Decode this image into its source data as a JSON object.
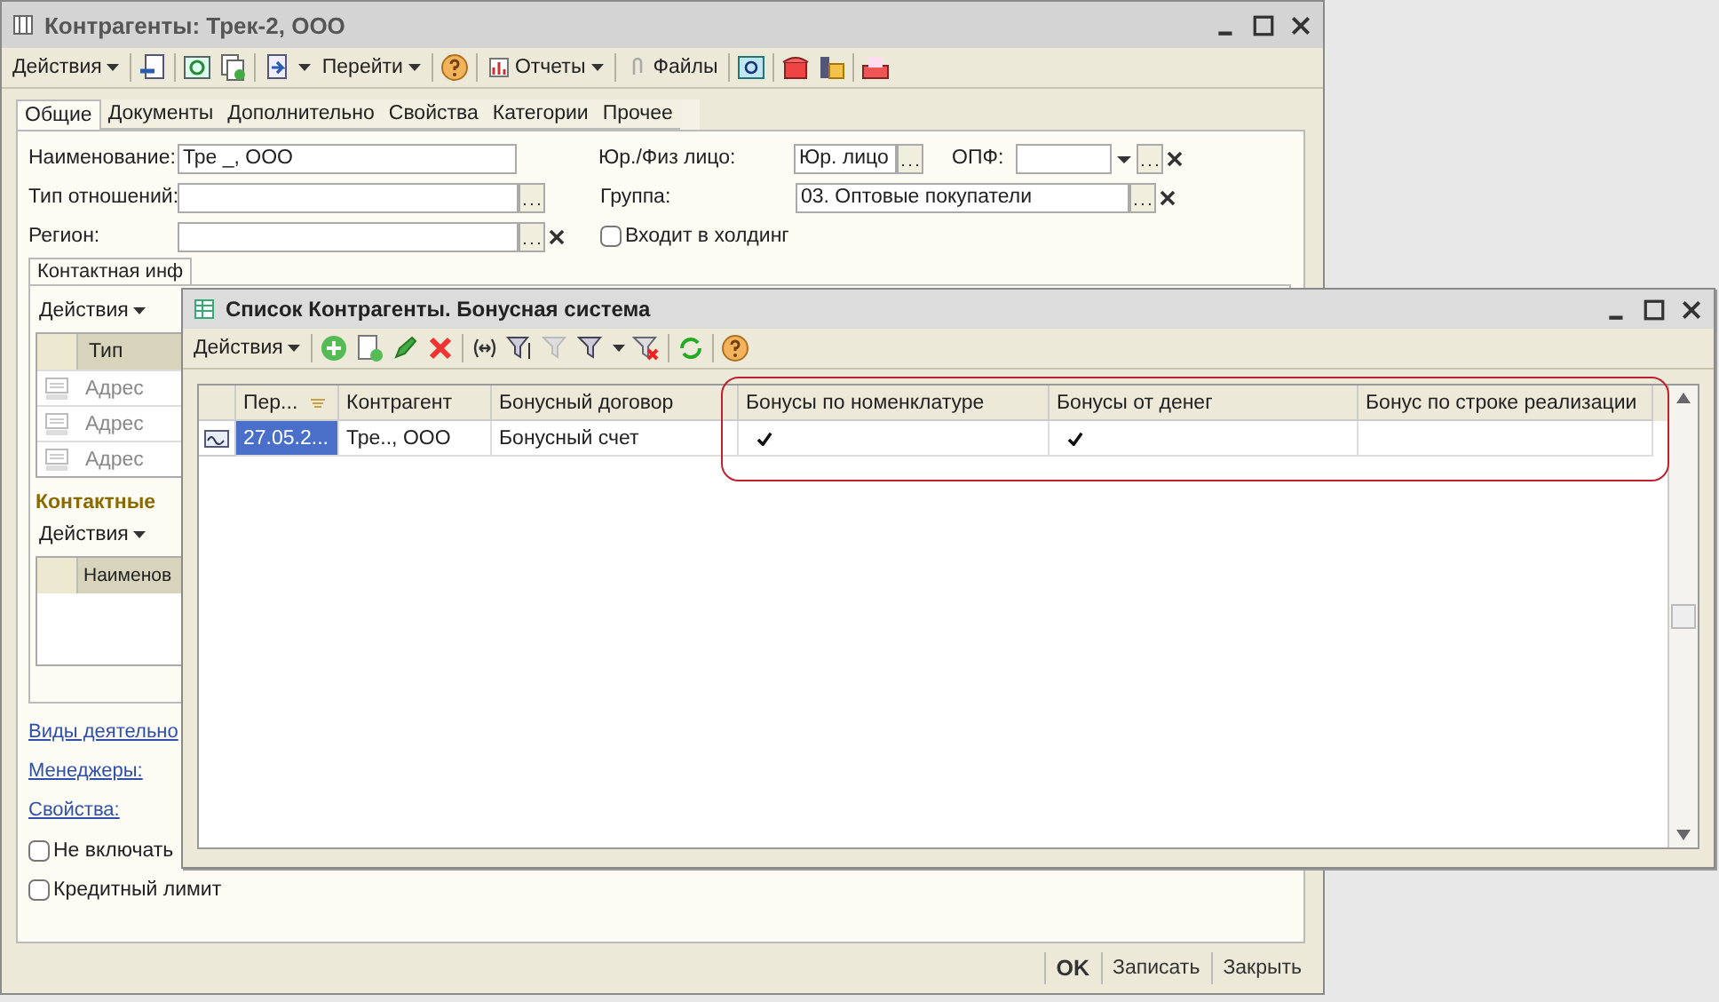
{
  "main_window": {
    "title": "Контрагенты: Трек-2, ООО",
    "toolbar": {
      "actions": "Действия",
      "goto": "Перейти",
      "reports": "Отчеты",
      "files": "Файлы"
    },
    "tabs": [
      {
        "label": "Общие",
        "selected": true
      },
      {
        "label": "Документы",
        "selected": false
      },
      {
        "label": "Дополнительно",
        "selected": false
      },
      {
        "label": "Свойства",
        "selected": false
      },
      {
        "label": "Категории",
        "selected": false
      },
      {
        "label": "Прочее",
        "selected": false
      }
    ],
    "name": {
      "label": "Наименование:",
      "value": "Тре _, ООО"
    },
    "relation_type": {
      "label": "Тип отношений:"
    },
    "region": {
      "label": "Регион:"
    },
    "legal_type": {
      "label": "Юр./Физ лицо:",
      "value": "Юр. лицо"
    },
    "opf": {
      "label": "ОПФ:"
    },
    "group": {
      "label": "Группа:",
      "value": "03. Оптовые покупатели"
    },
    "holding": {
      "label": "Входит в холдинг",
      "checked": false
    },
    "subtab": "Контактная инф",
    "contact_menu": "Действия",
    "contact_table": {
      "columns": [
        "Тип"
      ],
      "rows": [
        "Адрес",
        "Адрес",
        "Адрес"
      ]
    },
    "persons_heading": "Контактные",
    "persons_menu": "Действия",
    "persons_columns": [
      "Наименов"
    ],
    "links": [
      "Виды деятельно",
      "Менеджеры:",
      "Свойства:"
    ],
    "checkboxes": [
      {
        "label": "Не включать",
        "checked": false
      },
      {
        "label": "Кредитный лимит",
        "checked": false
      }
    ],
    "buttons": [
      {
        "label": "OK",
        "kind": "default"
      },
      {
        "label": "Записать",
        "kind": "normal"
      },
      {
        "label": "Закрыть",
        "kind": "normal"
      }
    ]
  },
  "list_window": {
    "title": "Список Контрагенты. Бонусная система",
    "menu": "Действия",
    "columns": [
      "Пер...",
      "Контрагент",
      "Бонусный договор",
      "Бонусы по номенклатуре",
      "Бонусы от денег",
      "Бонус по строке реализации"
    ],
    "rows": [
      {
        "cells": [
          "27.05.2...",
          "Тре.., ООО",
          "Бонусный счет"
        ],
        "checks": [
          true,
          true,
          false
        ],
        "selected": true
      }
    ]
  }
}
